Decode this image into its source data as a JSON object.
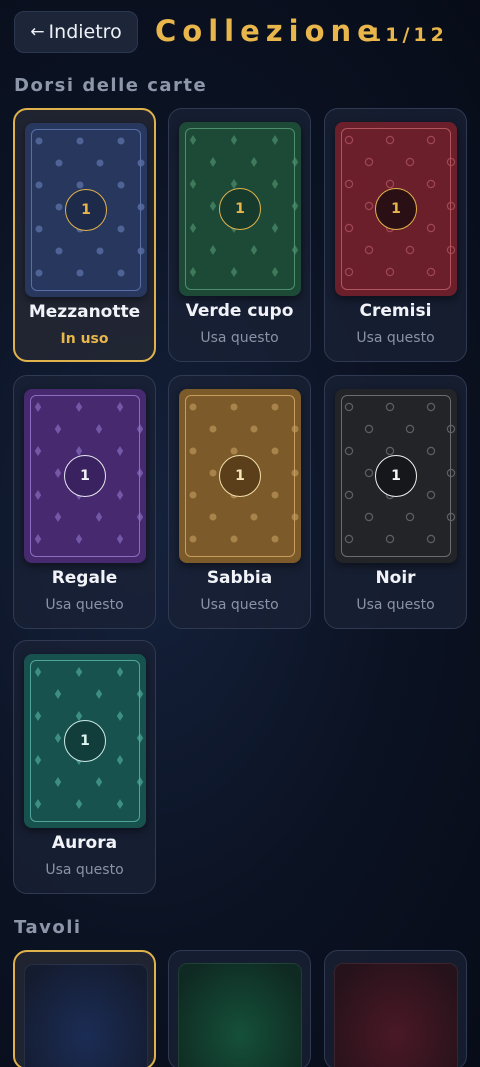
{
  "header": {
    "back_label": "Indietro",
    "back_arrow": "←",
    "title": "Collezione",
    "counter": "11/12"
  },
  "sections": {
    "card_backs_title": "Dorsi delle carte",
    "tables_title": "Tavoli"
  },
  "card_backs": [
    {
      "name": "Mezzanotte",
      "status": "In uso",
      "badge": "1",
      "pattern": "dot",
      "active": true,
      "colors": {
        "bg": "#28375e",
        "frame": "#5a6fa8",
        "pattern": "#4f6396",
        "badge_bg": "#1e2a4a",
        "badge_border": "#e0b24b",
        "badge_text": "#e8b64a"
      }
    },
    {
      "name": "Verde cupo",
      "status": "Usa questo",
      "badge": "1",
      "pattern": "diamond",
      "active": false,
      "colors": {
        "bg": "#1c4a37",
        "frame": "#4e8f6d",
        "pattern": "#3e7a5b",
        "badge_bg": "#163a2b",
        "badge_border": "#e0b24b",
        "badge_text": "#e8b64a"
      }
    },
    {
      "name": "Cremisi",
      "status": "Usa questo",
      "badge": "1",
      "pattern": "ring",
      "active": false,
      "colors": {
        "bg": "#6b1f2a",
        "frame": "#b15560",
        "pattern": "#a04754",
        "badge_bg": "#2a1014",
        "badge_border": "#e0b24b",
        "badge_text": "#e8b64a"
      }
    },
    {
      "name": "Regale",
      "status": "Usa questo",
      "badge": "1",
      "pattern": "diamond",
      "active": false,
      "colors": {
        "bg": "#47296f",
        "frame": "#8c6cc0",
        "pattern": "#7458a8",
        "badge_bg": "#3a2260",
        "badge_border": "#e6e6f0",
        "badge_text": "#f2f2f8"
      }
    },
    {
      "name": "Sabbia",
      "status": "Usa questo",
      "badge": "1",
      "pattern": "dot",
      "active": false,
      "colors": {
        "bg": "#7c5a2a",
        "frame": "#c79c5c",
        "pattern": "#a8844c",
        "badge_bg": "#5a3f1a",
        "badge_border": "#f1dfa8",
        "badge_text": "#f5e6b8"
      }
    },
    {
      "name": "Noir",
      "status": "Usa questo",
      "badge": "1",
      "pattern": "ring",
      "active": false,
      "colors": {
        "bg": "#232427",
        "frame": "#6a6c70",
        "pattern": "#5d5f63",
        "badge_bg": "#16171a",
        "badge_border": "#f0f0f0",
        "badge_text": "#f5f5f5"
      }
    },
    {
      "name": "Aurora",
      "status": "Usa questo",
      "badge": "1",
      "pattern": "diamond",
      "active": false,
      "colors": {
        "bg": "#17524f",
        "frame": "#4fa59b",
        "pattern": "#3d8f86",
        "badge_bg": "#113e3b",
        "badge_border": "#cdebe6",
        "badge_text": "#dff5f1"
      }
    }
  ],
  "tables": [
    {
      "active": true,
      "colors": {
        "center": "#1b2c55",
        "edge": "#141c30"
      }
    },
    {
      "active": false,
      "colors": {
        "center": "#15503a",
        "edge": "#0f2a22"
      }
    },
    {
      "active": false,
      "colors": {
        "center": "#4a1826",
        "edge": "#26121a"
      }
    }
  ]
}
